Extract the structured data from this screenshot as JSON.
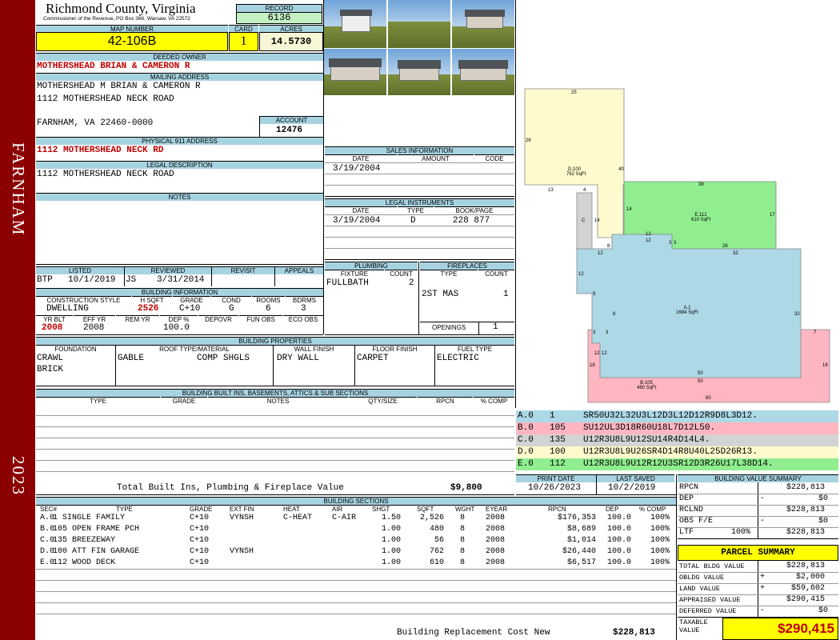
{
  "sidebar": {
    "location": "FARNHAM",
    "year": "2023"
  },
  "header": {
    "county": "Richmond County, Virginia",
    "commissioner": "Commissioner of the Revenue, PO Box 366, Warsaw, VA 22572",
    "record_label": "RECORD",
    "record": "6136"
  },
  "map": {
    "map_number_label": "MAP NUMBER",
    "map_number": "42-106B",
    "card_label": "CARD",
    "card": "1",
    "acres_label": "ACRES",
    "acres": "14.5730"
  },
  "owner": {
    "label": "DEEDED OWNER",
    "name": "MOTHERSHEAD BRIAN & CAMERON R"
  },
  "mailing": {
    "label": "MAILING ADDRESS",
    "line1": "MOTHERSHEAD M BRIAN & CAMERON R",
    "line2": "1112 MOTHERSHEAD NECK ROAD",
    "line3": "FARNHAM, VA 22460-0000"
  },
  "account": {
    "label": "ACCOUNT",
    "value": "12476"
  },
  "physical": {
    "label": "PHYSICAL 911 ADDRESS",
    "value": "1112 MOTHERSHEAD NECK RD"
  },
  "legal": {
    "label": "LEGAL DESCRIPTION",
    "value": "1112 MOTHERSHEAD NECK ROAD"
  },
  "notes": {
    "label": "NOTES"
  },
  "sales": {
    "label": "SALES INFORMATION",
    "cols": [
      "DATE",
      "AMOUNT",
      "CODE"
    ],
    "rows": [
      [
        "3/19/2004",
        "",
        ""
      ]
    ]
  },
  "instruments": {
    "label": "LEGAL INSTRUMENTS",
    "cols": [
      "DATE",
      "TYPE",
      "BOOK/PAGE"
    ],
    "rows": [
      [
        "3/19/2004",
        "D",
        "228 877"
      ]
    ]
  },
  "listing": {
    "listed_label": "LISTED",
    "listed_by": "BTP",
    "listed_date": "10/1/2019",
    "reviewed_label": "REVIEWED",
    "reviewed_by": "JS",
    "reviewed_date": "3/31/2014",
    "revisit_label": "REVISIT",
    "appeals_label": "APPEALS"
  },
  "building_info": {
    "label": "BUILDING INFORMATION",
    "cols": [
      "CONSTRUCTION STYLE",
      "H SQFT",
      "GRADE",
      "COND",
      "ROOMS",
      "BDRMS"
    ],
    "style": "DWELLING",
    "hsqft": "2526",
    "grade": "C+10",
    "cond": "G",
    "rooms": "6",
    "bdrms": "3",
    "cols2": [
      "YR BLT",
      "EFF YR",
      "REM YR",
      "DEP %",
      "DEPOVR",
      "FUN OBS",
      "ECO OBS"
    ],
    "yr_blt": "2008",
    "eff_yr": "2008",
    "rem_yr": "",
    "dep_pct": "100.0"
  },
  "plumbing": {
    "label": "PLUMBING",
    "fixture_label": "FIXTURE",
    "count_label": "COUNT",
    "fixture": "FULLBATH",
    "count": "2"
  },
  "fireplaces": {
    "label": "FIREPLACES",
    "type_label": "TYPE",
    "count_label": "COUNT",
    "type": "2ST MAS",
    "count": "1",
    "openings_label": "OPENINGS",
    "openings": "1"
  },
  "properties": {
    "label": "BUILDING PROPERTIES",
    "cols": [
      "FOUNDATION",
      "ROOF TYPE/MATERIAL",
      "WALL FINISH",
      "FLOOR FINISH",
      "FUEL TYPE"
    ],
    "foundation1": "CRAWL",
    "foundation2": "BRICK",
    "roof_type": "GABLE",
    "roof_material": "COMP SHGLS",
    "wall": "DRY WALL",
    "floor": "CARPET",
    "fuel": "ELECTRIC"
  },
  "builtins": {
    "label": "BUILDING BUILT INS, BASEMENTS, ATTICS & SUB SECTIONS",
    "cols": [
      "TYPE",
      "GRADE",
      "NOTES",
      "QTY/SIZE",
      "RPCN",
      "% COMP"
    ],
    "total_label": "Total Built Ins, Plumbing & Fireplace Value",
    "total": "$9,800"
  },
  "sketch": {
    "labels": [
      {
        "id": "d100",
        "t1": "D.100",
        "t2": "762 SqFt"
      },
      {
        "id": "e112",
        "t1": "E.112",
        "t2": "610 SqFt"
      },
      {
        "id": "a1",
        "t1": "A.1",
        "t2": "1684 SqFt"
      },
      {
        "id": "b105",
        "t1": "B.105",
        "t2": "480 SqFt"
      },
      {
        "id": "c",
        "t1": "C",
        "t2": ""
      }
    ],
    "dims": [
      "25",
      "26",
      "40",
      "13",
      "4",
      "14",
      "14",
      "38",
      "17",
      "12",
      "12",
      "8",
      "3",
      "3",
      "26",
      "32",
      "12",
      "12",
      "9",
      "8",
      "32",
      "3",
      "3",
      "7",
      "12",
      "12",
      "18",
      "18",
      "50",
      "50",
      "60"
    ]
  },
  "legend": [
    {
      "sec": "A.0",
      "code": "1",
      "path": "SR50U32L32U3L12D3L12D12R9D8L3D12.",
      "color": "#add8e6"
    },
    {
      "sec": "B.0",
      "code": "105",
      "path": "SU12UL3D18R60U18L7D12L50.",
      "color": "#ffb6c1"
    },
    {
      "sec": "C.0",
      "code": "135",
      "path": "U12R3U8L9U12SU14R4D14L4.",
      "color": "#d3d3d3"
    },
    {
      "sec": "D.0",
      "code": "100",
      "path": "U12R3U8L9U26SR4D14R8U40L25D26R13.",
      "color": "#fffacd"
    },
    {
      "sec": "E.0",
      "code": "112",
      "path": "U12R3U8L9U12R12U3SR12D3R26U17L38D14.",
      "color": "#90ee90"
    }
  ],
  "dates": {
    "print_label": "PRINT DATE",
    "print": "10/26/2023",
    "saved_label": "LAST SAVED",
    "saved": "10/2/2019"
  },
  "sections": {
    "label": "BUILDING SECTIONS",
    "cols": [
      "SEC#",
      "TYPE",
      "GRADE",
      "EXT FIN",
      "HEAT",
      "AIR",
      "SHGT",
      "SQFT",
      "WGHT",
      "EYEAR",
      "RPCN",
      "DEP",
      "% COMP"
    ],
    "rows": [
      [
        "A.0",
        "1 SINGLE FAMILY",
        "C+10",
        "VYNSH",
        "C-HEAT",
        "C-AIR",
        "1.50",
        "2,526",
        "8",
        "2008",
        "$176,353",
        "100.0",
        "100%"
      ],
      [
        "B.0",
        "105 OPEN FRAME PCH",
        "C+10",
        "",
        "",
        "",
        "1.00",
        "480",
        "8",
        "2008",
        "$8,689",
        "100.0",
        "100%"
      ],
      [
        "C.0",
        "135 BREEZEWAY",
        "C+10",
        "",
        "",
        "",
        "1.00",
        "56",
        "8",
        "2008",
        "$1,014",
        "100.0",
        "100%"
      ],
      [
        "D.0",
        "100 ATT FIN GARAGE",
        "C+10",
        "VYNSH",
        "",
        "",
        "1.00",
        "762",
        "8",
        "2008",
        "$26,440",
        "100.0",
        "100%"
      ],
      [
        "E.0",
        "112 WOOD DECK",
        "C+10",
        "",
        "",
        "",
        "1.00",
        "610",
        "8",
        "2008",
        "$6,517",
        "100.0",
        "100%"
      ]
    ],
    "rcn_label": "Building Replacement Cost New",
    "rcn": "$228,813"
  },
  "bvs": {
    "label": "BUILDING VALUE SUMMARY",
    "rpcn_label": "RPCN",
    "rpcn": "$228,813",
    "dep_label": "DEP",
    "dep_sign": "-",
    "dep": "$0",
    "rclnd_label": "RCLND",
    "rclnd": "$228,813",
    "obs_label": "OBS F/E",
    "obs_sign": "-",
    "obs": "$0",
    "ltf_label": "LTF",
    "ltf_pct": "100%",
    "ltf": "$228,813"
  },
  "parcel": {
    "label": "PARCEL SUMMARY",
    "tbv_label": "TOTAL BLDG VALUE",
    "tbv": "$228,813",
    "obldg_label": "OBLDG VALUE",
    "obldg_sign": "+",
    "obldg": "$2,000",
    "land_label": "LAND VALUE",
    "land_sign": "+",
    "land": "$59,602",
    "appraised_label": "APPRAISED VALUE",
    "appraised": "$290,415",
    "deferred_label": "DEFERRED VALUE",
    "deferred_sign": "-",
    "deferred": "$0",
    "taxable_label1": "TAXABLE",
    "taxable_label2": "VALUE",
    "taxable": "$290,415"
  }
}
